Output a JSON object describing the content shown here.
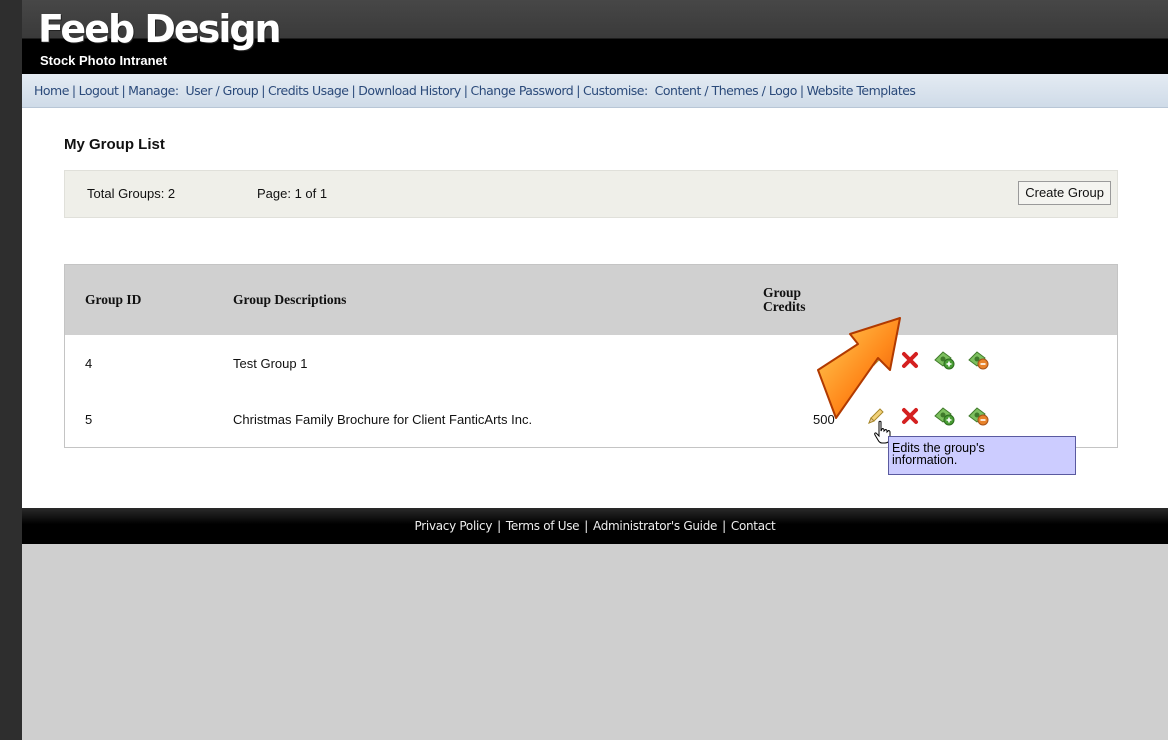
{
  "brand": {
    "title": "Feeb Design",
    "subtitle": "Stock Photo Intranet"
  },
  "nav": {
    "home": "Home",
    "logout": "Logout",
    "manage_label": "Manage:",
    "user": "User",
    "group": "Group",
    "credits_usage": "Credits Usage",
    "download_history": "Download History",
    "change_password": "Change Password",
    "customise_label": "Customise:",
    "content": "Content",
    "themes": "Themes",
    "logo": "Logo",
    "website_templates": "Website Templates"
  },
  "page": {
    "title": "My Group List",
    "total_groups": "Total Groups: 2",
    "page_info": "Page: 1 of 1",
    "create_group_label": "Create Group"
  },
  "table": {
    "headers": {
      "id": "Group ID",
      "description": "Group Descriptions",
      "credits_line1": "Group",
      "credits_line2": "Credits"
    },
    "rows": [
      {
        "id": "4",
        "description": "Test Group 1",
        "credits": ""
      },
      {
        "id": "5",
        "description": "Christmas Family Brochure for Client FanticArts Inc.",
        "credits": "500"
      }
    ]
  },
  "icons": {
    "edit": "pencil-icon",
    "delete": "red-x-icon",
    "add_credits": "money-add-icon",
    "remove_credits": "money-remove-icon"
  },
  "tooltip": {
    "line1": "Edits the group's",
    "line2": "information."
  },
  "footer": {
    "privacy": "Privacy Policy",
    "terms": "Terms of Use",
    "admin_guide": "Administrator's Guide",
    "contact": "Contact"
  },
  "colors": {
    "nav_link": "#2b4a7a",
    "tooltip_bg": "#ccccff",
    "callout": "#f26a00",
    "delete_icon": "#d42020",
    "money_icon": "#5aa046"
  }
}
